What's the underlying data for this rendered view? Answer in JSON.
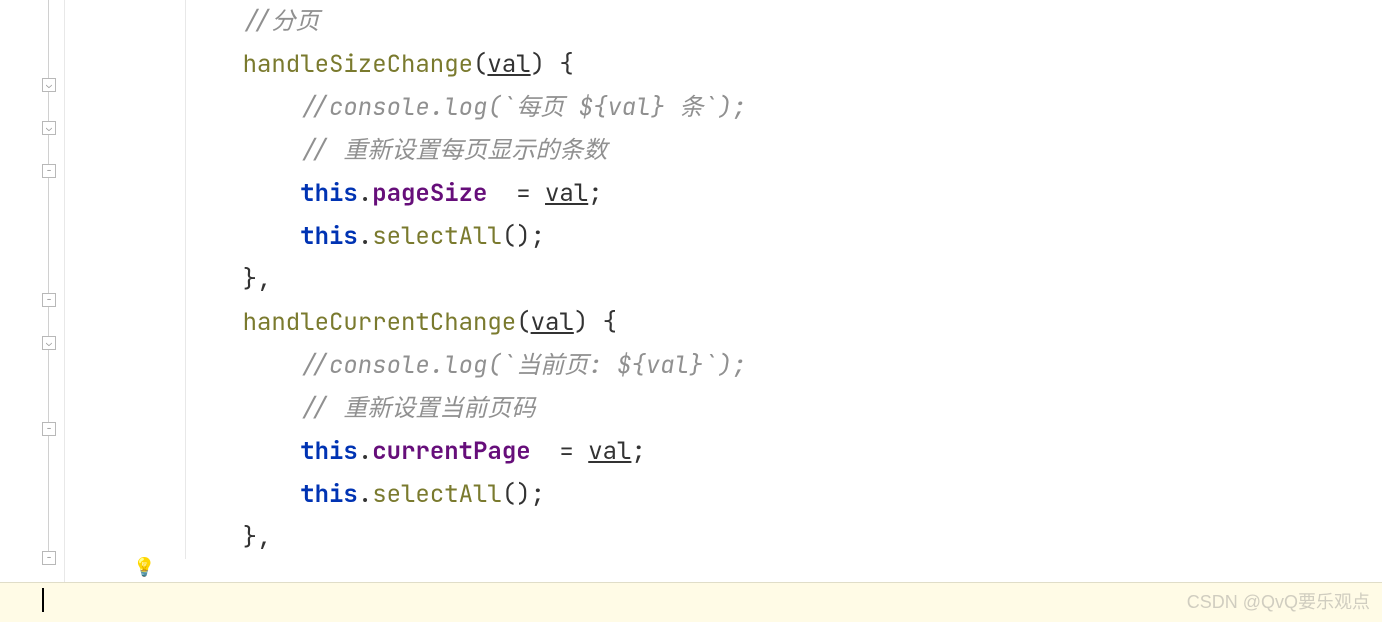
{
  "watermark": "CSDN @QvQ要乐观点",
  "code": {
    "l1": {
      "comment": "//分页"
    },
    "l2": {
      "method": "handleSizeChange",
      "paren_open": "(",
      "param": "val",
      "paren_close_brace": ") {"
    },
    "l3": {
      "comment": "//console.log(`每页 ${val} 条`);"
    },
    "l4": {
      "comment": "// 重新设置每页显示的条数"
    },
    "l5": {
      "this": "this",
      "dot": ".",
      "prop": "pageSize",
      "assign": "  = ",
      "val": "val",
      "semi": ";"
    },
    "l6": {
      "this": "this",
      "dot": ".",
      "call": "selectAll",
      "rest": "();"
    },
    "l7": {
      "close": "},"
    },
    "l8": {
      "method": "handleCurrentChange",
      "paren_open": "(",
      "param": "val",
      "paren_close_brace": ") {"
    },
    "l9": {
      "comment": "//console.log(`当前页: ${val}`);"
    },
    "l10": {
      "comment": "// 重新设置当前页码"
    },
    "l11": {
      "this": "this",
      "dot": ".",
      "prop": "currentPage",
      "assign": "  = ",
      "val": "val",
      "semi": ";"
    },
    "l12": {
      "this": "this",
      "dot": ".",
      "call": "selectAll",
      "rest": "();"
    },
    "l13": {
      "close": "},"
    }
  }
}
